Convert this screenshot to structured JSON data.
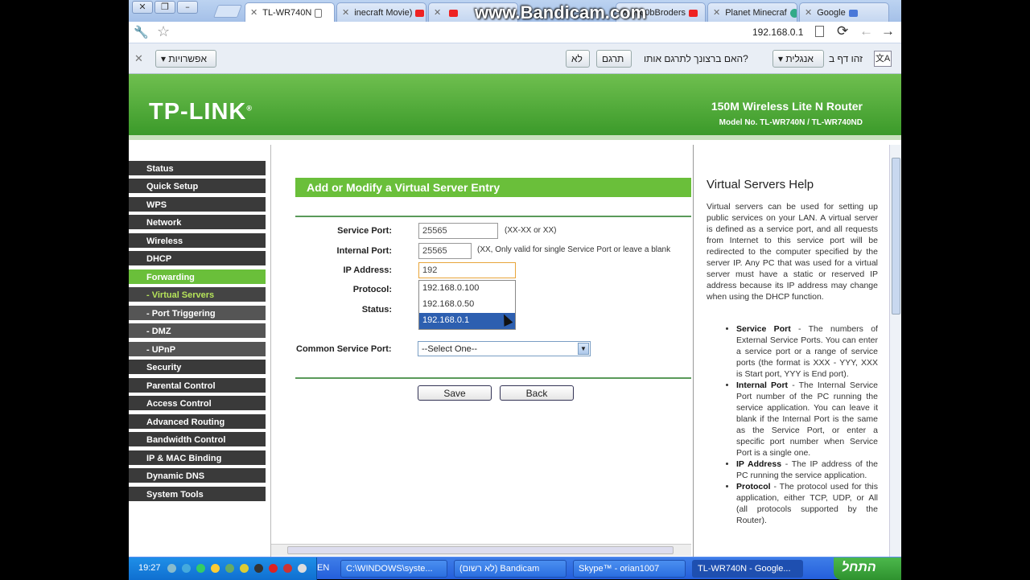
{
  "browser": {
    "tabs": [
      {
        "label": "TL-WR740N",
        "icon": "page-icon"
      },
      {
        "label": "inecraft Movie)",
        "icon": "youtube-icon"
      },
      {
        "label": "",
        "icon": "youtube-icon"
      },
      {
        "label": "N00bBroders",
        "icon": "youtube-icon"
      },
      {
        "label": "Planet Minecraf",
        "icon": "globe-icon"
      },
      {
        "label": "Google",
        "icon": "google-icon"
      }
    ],
    "watermark": "www.Bandicam.com",
    "url": "192.168.0.1"
  },
  "translate_bar": {
    "options_label": "אפשרויות",
    "no_label": "לא",
    "translate_label": "תרגם",
    "question": "האם ברצונך לתרגם אותו?",
    "language": "אנגלית",
    "page_in": "זהו דף ב"
  },
  "router": {
    "logo": "TP-LINK",
    "product": "150M Wireless Lite N Router",
    "model": "Model No. TL-WR740N / TL-WR740ND"
  },
  "menu": [
    {
      "label": "Status",
      "state": "normal"
    },
    {
      "label": "Quick Setup",
      "state": "normal"
    },
    {
      "label": "WPS",
      "state": "normal"
    },
    {
      "label": "Network",
      "state": "normal"
    },
    {
      "label": "Wireless",
      "state": "normal"
    },
    {
      "label": "DHCP",
      "state": "normal"
    },
    {
      "label": "Forwarding",
      "state": "active"
    },
    {
      "label": "- Virtual Servers",
      "state": "subactive"
    },
    {
      "label": "- Port Triggering",
      "state": "sub"
    },
    {
      "label": "- DMZ",
      "state": "sub"
    },
    {
      "label": "- UPnP",
      "state": "sub"
    },
    {
      "label": "Security",
      "state": "normal"
    },
    {
      "label": "Parental Control",
      "state": "normal"
    },
    {
      "label": "Access Control",
      "state": "normal"
    },
    {
      "label": "Advanced Routing",
      "state": "normal"
    },
    {
      "label": "Bandwidth Control",
      "state": "normal"
    },
    {
      "label": "IP & MAC Binding",
      "state": "normal"
    },
    {
      "label": "Dynamic DNS",
      "state": "normal"
    },
    {
      "label": "System Tools",
      "state": "normal"
    }
  ],
  "form": {
    "title": "Add or Modify a Virtual Server Entry",
    "service_port_label": "Service Port:",
    "service_port_value": "25565",
    "service_port_note": "(XX-XX or XX)",
    "internal_port_label": "Internal Port:",
    "internal_port_value": "25565",
    "internal_port_note": "(XX, Only valid for single Service Port or leave a blank",
    "ip_label": "IP Address:",
    "ip_value": "192",
    "protocol_label": "Protocol:",
    "status_label": "Status:",
    "common_port_label": "Common Service Port:",
    "common_port_value": "--Select One--",
    "autocomplete": [
      "192.168.0.100",
      "192.168.0.50",
      "192.168.0.1"
    ],
    "save_label": "Save",
    "back_label": "Back"
  },
  "help": {
    "title": "Virtual Servers Help",
    "intro": "Virtual servers can be used for setting up public services on your LAN. A virtual server is defined as a service port, and all requests from Internet to this service port will be redirected to the computer specified by the server IP. Any PC that was used for a virtual server must have a static or reserved IP address because its IP address may change when using the DHCP function.",
    "items": [
      {
        "term": "Service Port",
        "text": " - The numbers of External Service Ports. You can enter a service port or a range of service ports (the format is XXX - YYY, XXX is Start port, YYY is End port)."
      },
      {
        "term": "Internal Port",
        "text": " - The Internal Service Port number of the PC running the service application. You can leave it blank if the Internal Port is the same as the Service Port, or enter a specific port number when Service Port is a single one."
      },
      {
        "term": "IP Address",
        "text": " - The IP address of the PC running the service application."
      },
      {
        "term": "Protocol",
        "text": " - The protocol used for this application, either TCP, UDP, or All (all protocols supported by the Router)."
      }
    ]
  },
  "taskbar": {
    "clock": "19:27",
    "lang": "EN",
    "tasks": [
      {
        "label": "C:\\WINDOWS\\syste..."
      },
      {
        "label": "(לא רשום) Bandicam"
      },
      {
        "label": "Skype™ - orian1007"
      },
      {
        "label": "TL-WR740N - Google..."
      }
    ],
    "start_label": "התחל"
  }
}
